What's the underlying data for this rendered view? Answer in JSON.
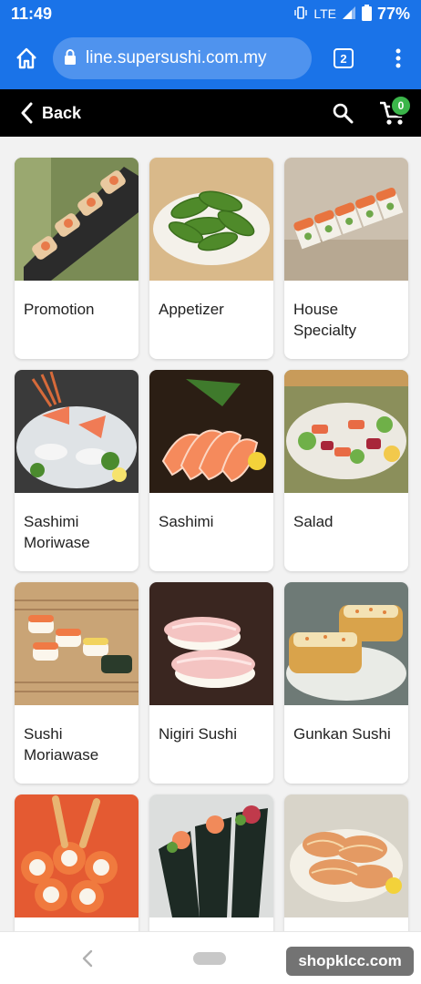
{
  "status_bar": {
    "time": "11:49",
    "network": "LTE",
    "battery": "77%"
  },
  "browser": {
    "url": "line.supersushi.com.my",
    "tab_count": "2"
  },
  "header": {
    "back_label": "Back",
    "cart_count": "0"
  },
  "categories": [
    {
      "label": "Promotion",
      "image": "promotion-photo"
    },
    {
      "label": "Appetizer",
      "image": "edamame-photo"
    },
    {
      "label": "House\nSpecialty",
      "image": "house-roll-photo"
    },
    {
      "label": "Sashimi\nMoriwase",
      "image": "sashimi-platter-photo"
    },
    {
      "label": "Sashimi",
      "image": "salmon-sashimi-photo"
    },
    {
      "label": "Salad",
      "image": "salad-photo"
    },
    {
      "label": "Sushi\nMoriawase",
      "image": "sushi-platter-photo"
    },
    {
      "label": "Nigiri Sushi",
      "image": "nigiri-photo"
    },
    {
      "label": "Gunkan Sushi",
      "image": "gunkan-photo"
    },
    {
      "label": "",
      "image": "tempura-roll-photo"
    },
    {
      "label": "",
      "image": "hand-roll-photo"
    },
    {
      "label": "",
      "image": "spicy-sushi-photo"
    }
  ],
  "watermark": "shopklcc.com",
  "colors": {
    "chrome_blue": "#1a73e8",
    "header_black": "#000000",
    "badge_green": "#3bb54a"
  }
}
